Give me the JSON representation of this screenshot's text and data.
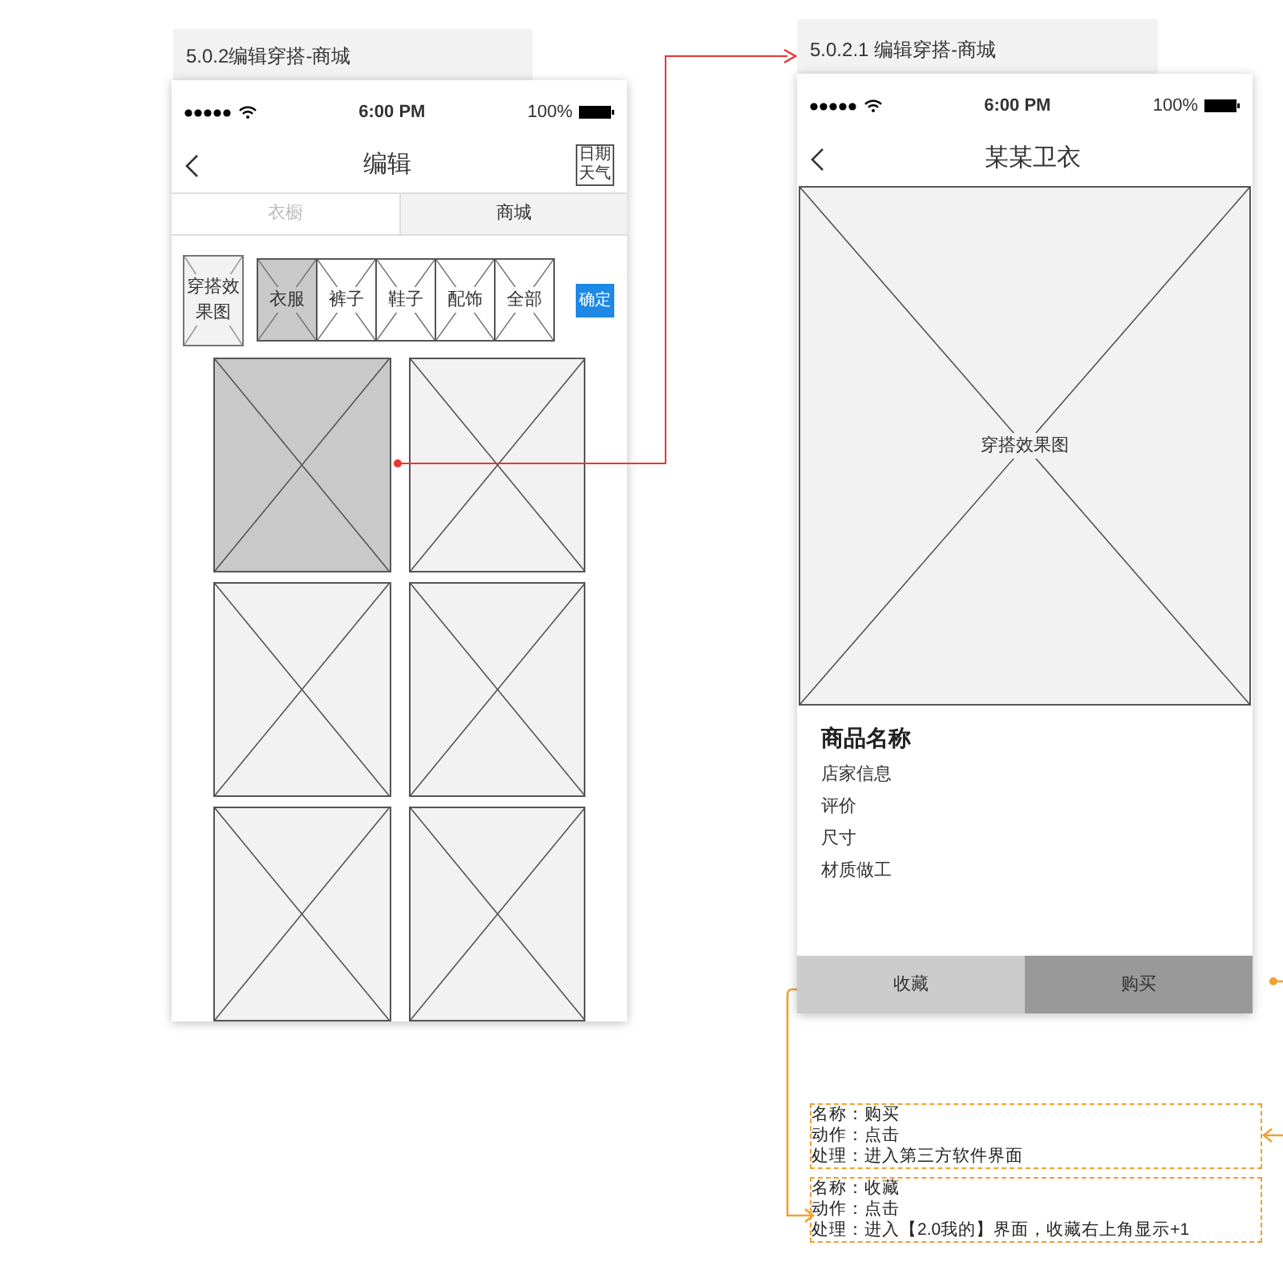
{
  "left_screen": {
    "label": "5.0.2编辑穿搭-商城",
    "status_bar": {
      "time": "6:00 PM",
      "battery": "100%"
    },
    "title": "编辑",
    "date_weather_button": [
      "日期",
      "天气"
    ],
    "tabs": [
      {
        "label": "衣橱",
        "selected": false
      },
      {
        "label": "商城",
        "selected": true
      }
    ],
    "outfit_preview": "穿搭效果图",
    "categories": [
      {
        "label": "衣服",
        "selected": true
      },
      {
        "label": "裤子",
        "selected": false
      },
      {
        "label": "鞋子",
        "selected": false
      },
      {
        "label": "配饰",
        "selected": false
      },
      {
        "label": "全部",
        "selected": false
      }
    ],
    "confirm_button": "确定",
    "products": [
      {
        "selected": true
      },
      {
        "selected": false
      },
      {
        "selected": false
      },
      {
        "selected": false
      },
      {
        "selected": false
      },
      {
        "selected": false
      }
    ]
  },
  "right_screen": {
    "label": "5.0.2.1 编辑穿搭-商城",
    "status_bar": {
      "time": "6:00 PM",
      "battery": "100%"
    },
    "title": "某某卫衣",
    "image_label": "穿搭效果图",
    "product_name": "商品名称",
    "details": [
      "店家信息",
      "评价",
      "尺寸",
      "材质做工"
    ],
    "buttons": [
      {
        "label": "收藏",
        "kind": "secondary"
      },
      {
        "label": "购买",
        "kind": "primary"
      }
    ]
  },
  "annotations": [
    {
      "lines": [
        "名称：购买",
        "动作：点击",
        "处理：进入第三方软件界面"
      ]
    },
    {
      "lines": [
        "名称：收藏",
        "动作：点击",
        "处理：进入【2.0我的】界面，收藏右上角显示+1"
      ]
    }
  ]
}
